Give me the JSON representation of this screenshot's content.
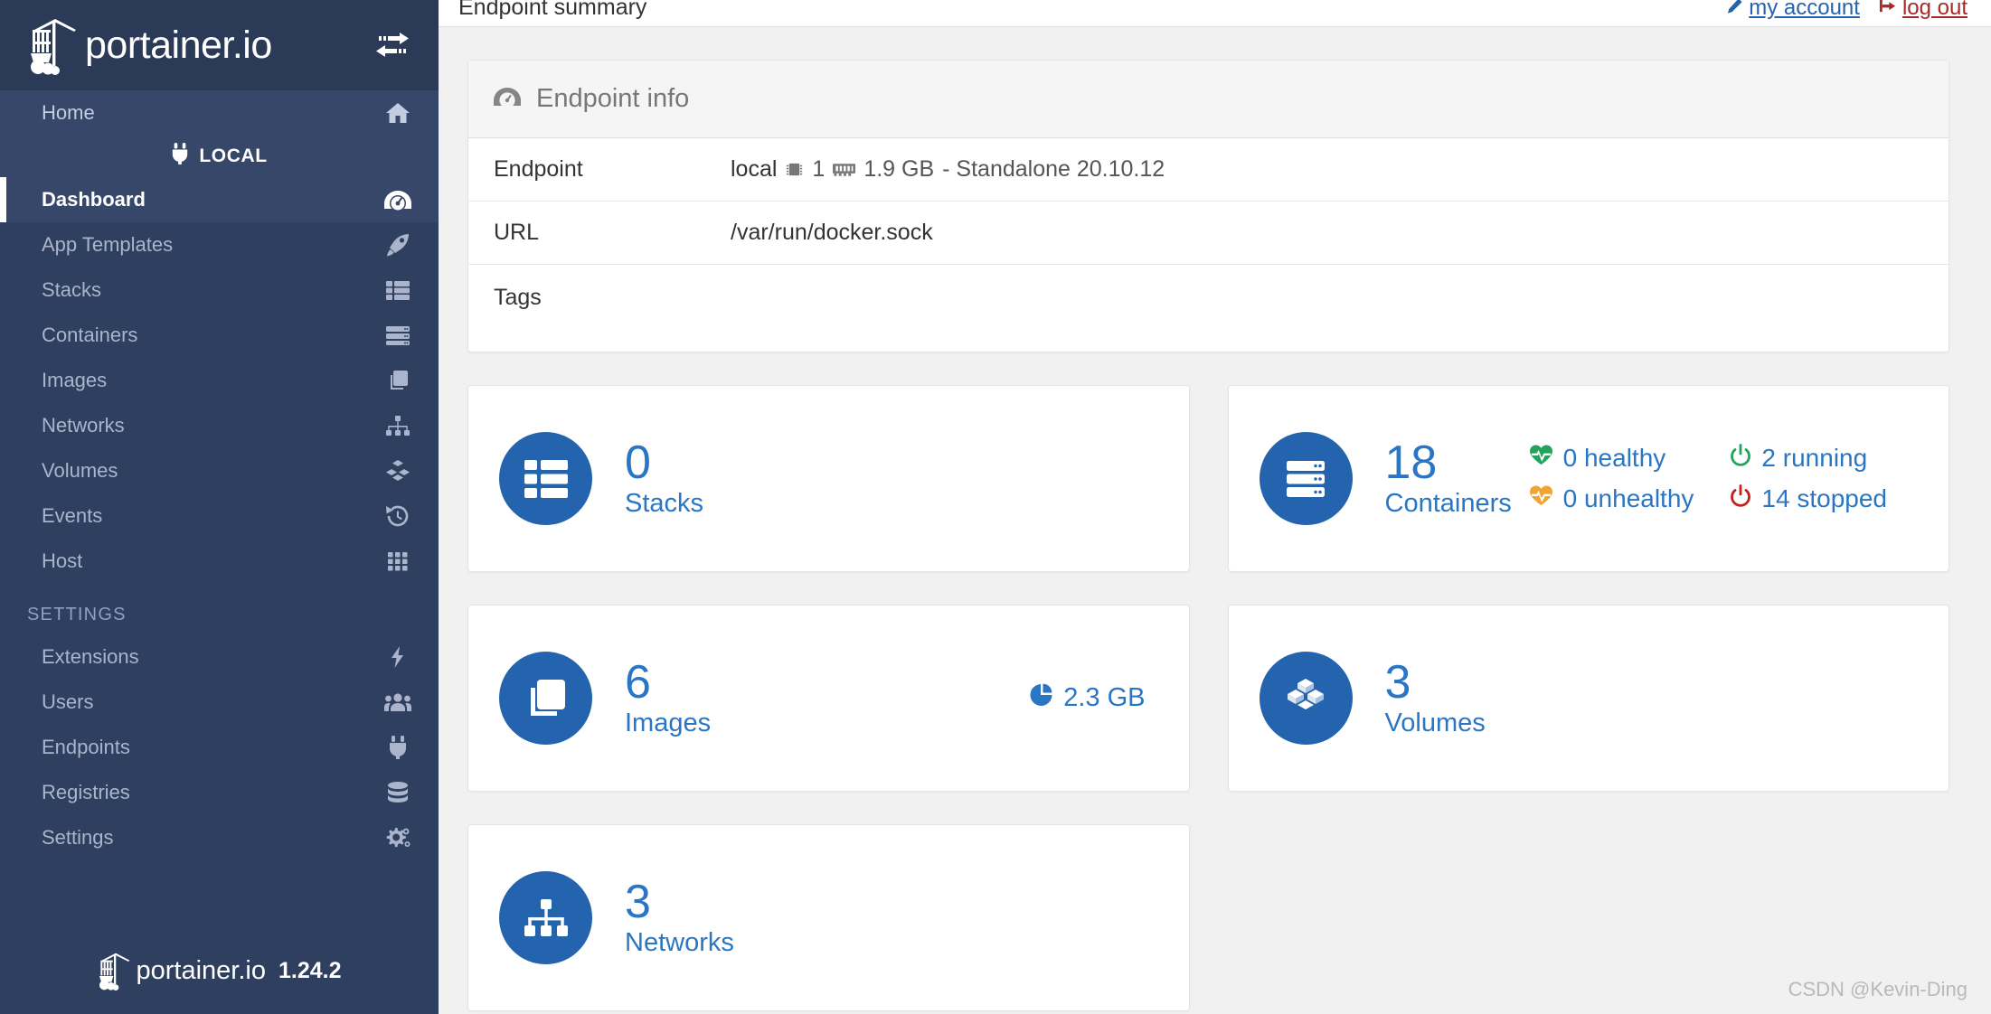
{
  "brand": {
    "name": "portainer.io",
    "version": "1.24.2"
  },
  "topbar": {
    "breadcrumb": "Endpoint summary",
    "account_label": "my account",
    "logout_label": "log out"
  },
  "sidebar": {
    "home_label": "Home",
    "local_label": "LOCAL",
    "settings_section": "SETTINGS",
    "items": [
      {
        "label": "Dashboard",
        "icon": "dashboard-icon",
        "active": true
      },
      {
        "label": "App Templates",
        "icon": "rocket-icon",
        "active": false
      },
      {
        "label": "Stacks",
        "icon": "stacks-icon",
        "active": false
      },
      {
        "label": "Containers",
        "icon": "containers-icon",
        "active": false
      },
      {
        "label": "Images",
        "icon": "images-icon",
        "active": false
      },
      {
        "label": "Networks",
        "icon": "networks-icon",
        "active": false
      },
      {
        "label": "Volumes",
        "icon": "volumes-icon",
        "active": false
      },
      {
        "label": "Events",
        "icon": "history-icon",
        "active": false
      },
      {
        "label": "Host",
        "icon": "grid-icon",
        "active": false
      }
    ],
    "settings_items": [
      {
        "label": "Extensions",
        "icon": "bolt-icon"
      },
      {
        "label": "Users",
        "icon": "users-icon"
      },
      {
        "label": "Endpoints",
        "icon": "plug-icon"
      },
      {
        "label": "Registries",
        "icon": "database-icon"
      },
      {
        "label": "Settings",
        "icon": "gears-icon"
      }
    ]
  },
  "endpoint_info": {
    "title": "Endpoint info",
    "rows": [
      {
        "key": "Endpoint",
        "value": "local",
        "cpu": "1",
        "memory": "1.9 GB",
        "suffix": "- Standalone 20.10.12"
      },
      {
        "key": "URL",
        "value": "/var/run/docker.sock"
      },
      {
        "key": "Tags",
        "value": ""
      }
    ]
  },
  "cards": {
    "stacks": {
      "count": "0",
      "label": "Stacks",
      "icon": "stacks-icon"
    },
    "images": {
      "count": "6",
      "label": "Images",
      "icon": "images-icon",
      "size": "2.3 GB",
      "size_icon": "pie-chart-icon"
    },
    "networks": {
      "count": "3",
      "label": "Networks",
      "icon": "networks-icon"
    },
    "containers": {
      "count": "18",
      "label": "Containers",
      "icon": "containers-icon",
      "statuses": [
        {
          "text": "0 healthy",
          "icon": "heartbeat-icon",
          "color": "#23a35b"
        },
        {
          "text": "2 running",
          "icon": "power-icon",
          "color": "#23a35b"
        },
        {
          "text": "0 unhealthy",
          "icon": "heartbeat-icon",
          "color": "#f0a532"
        },
        {
          "text": "14 stopped",
          "icon": "power-icon",
          "color": "#c0211c"
        }
      ]
    },
    "volumes": {
      "count": "3",
      "label": "Volumes",
      "icon": "volumes-icon"
    }
  },
  "watermark": "CSDN @Kevin-Ding",
  "colors": {
    "sidebar": "#2f3f5f",
    "accent_blue": "#2463ad",
    "text_blue": "#2a76c4",
    "link_red": "#a52a2a"
  }
}
